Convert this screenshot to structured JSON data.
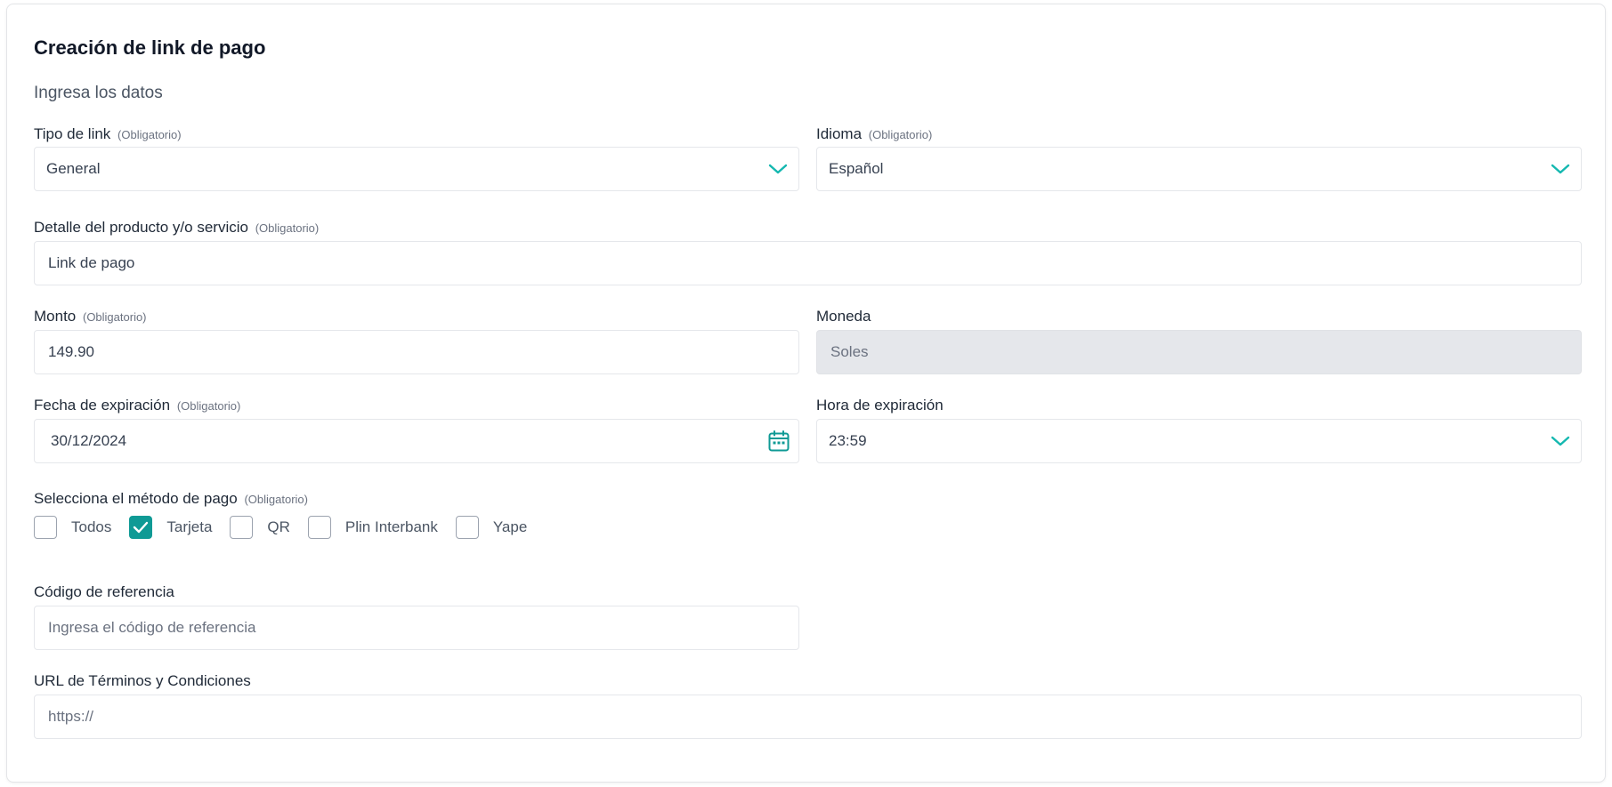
{
  "form": {
    "title": "Creación de link de pago",
    "subtitle": "Ingresa los datos",
    "required_tag": "(Obligatorio)",
    "link_type": {
      "label": "Tipo de link",
      "value": "General"
    },
    "language": {
      "label": "Idioma",
      "value": "Español"
    },
    "product_detail": {
      "label": "Detalle del producto y/o servicio",
      "value": "Link de pago"
    },
    "amount": {
      "label": "Monto",
      "value": "149.90"
    },
    "currency": {
      "label": "Moneda",
      "value": "Soles"
    },
    "expiration_date": {
      "label": "Fecha de expiración",
      "value": "30/12/2024"
    },
    "expiration_time": {
      "label": "Hora de expiración",
      "value": "23:59"
    },
    "payment_methods": {
      "label": "Selecciona el método de pago",
      "options": [
        {
          "label": "Todos",
          "checked": false
        },
        {
          "label": "Tarjeta",
          "checked": true
        },
        {
          "label": "QR",
          "checked": false
        },
        {
          "label": "Plin Interbank",
          "checked": false
        },
        {
          "label": "Yape",
          "checked": false
        }
      ]
    },
    "reference_code": {
      "label": "Código de referencia",
      "placeholder": "Ingresa el código de referencia"
    },
    "terms_url": {
      "label": "URL de Términos y Condiciones",
      "placeholder": "https://"
    }
  },
  "colors": {
    "accent": "#0f9a95",
    "disabled_bg": "#e5e7eb",
    "border": "#e5e7eb"
  },
  "icons": {
    "select": "chevron-down-icon",
    "date": "calendar-icon",
    "check": "check-icon"
  }
}
